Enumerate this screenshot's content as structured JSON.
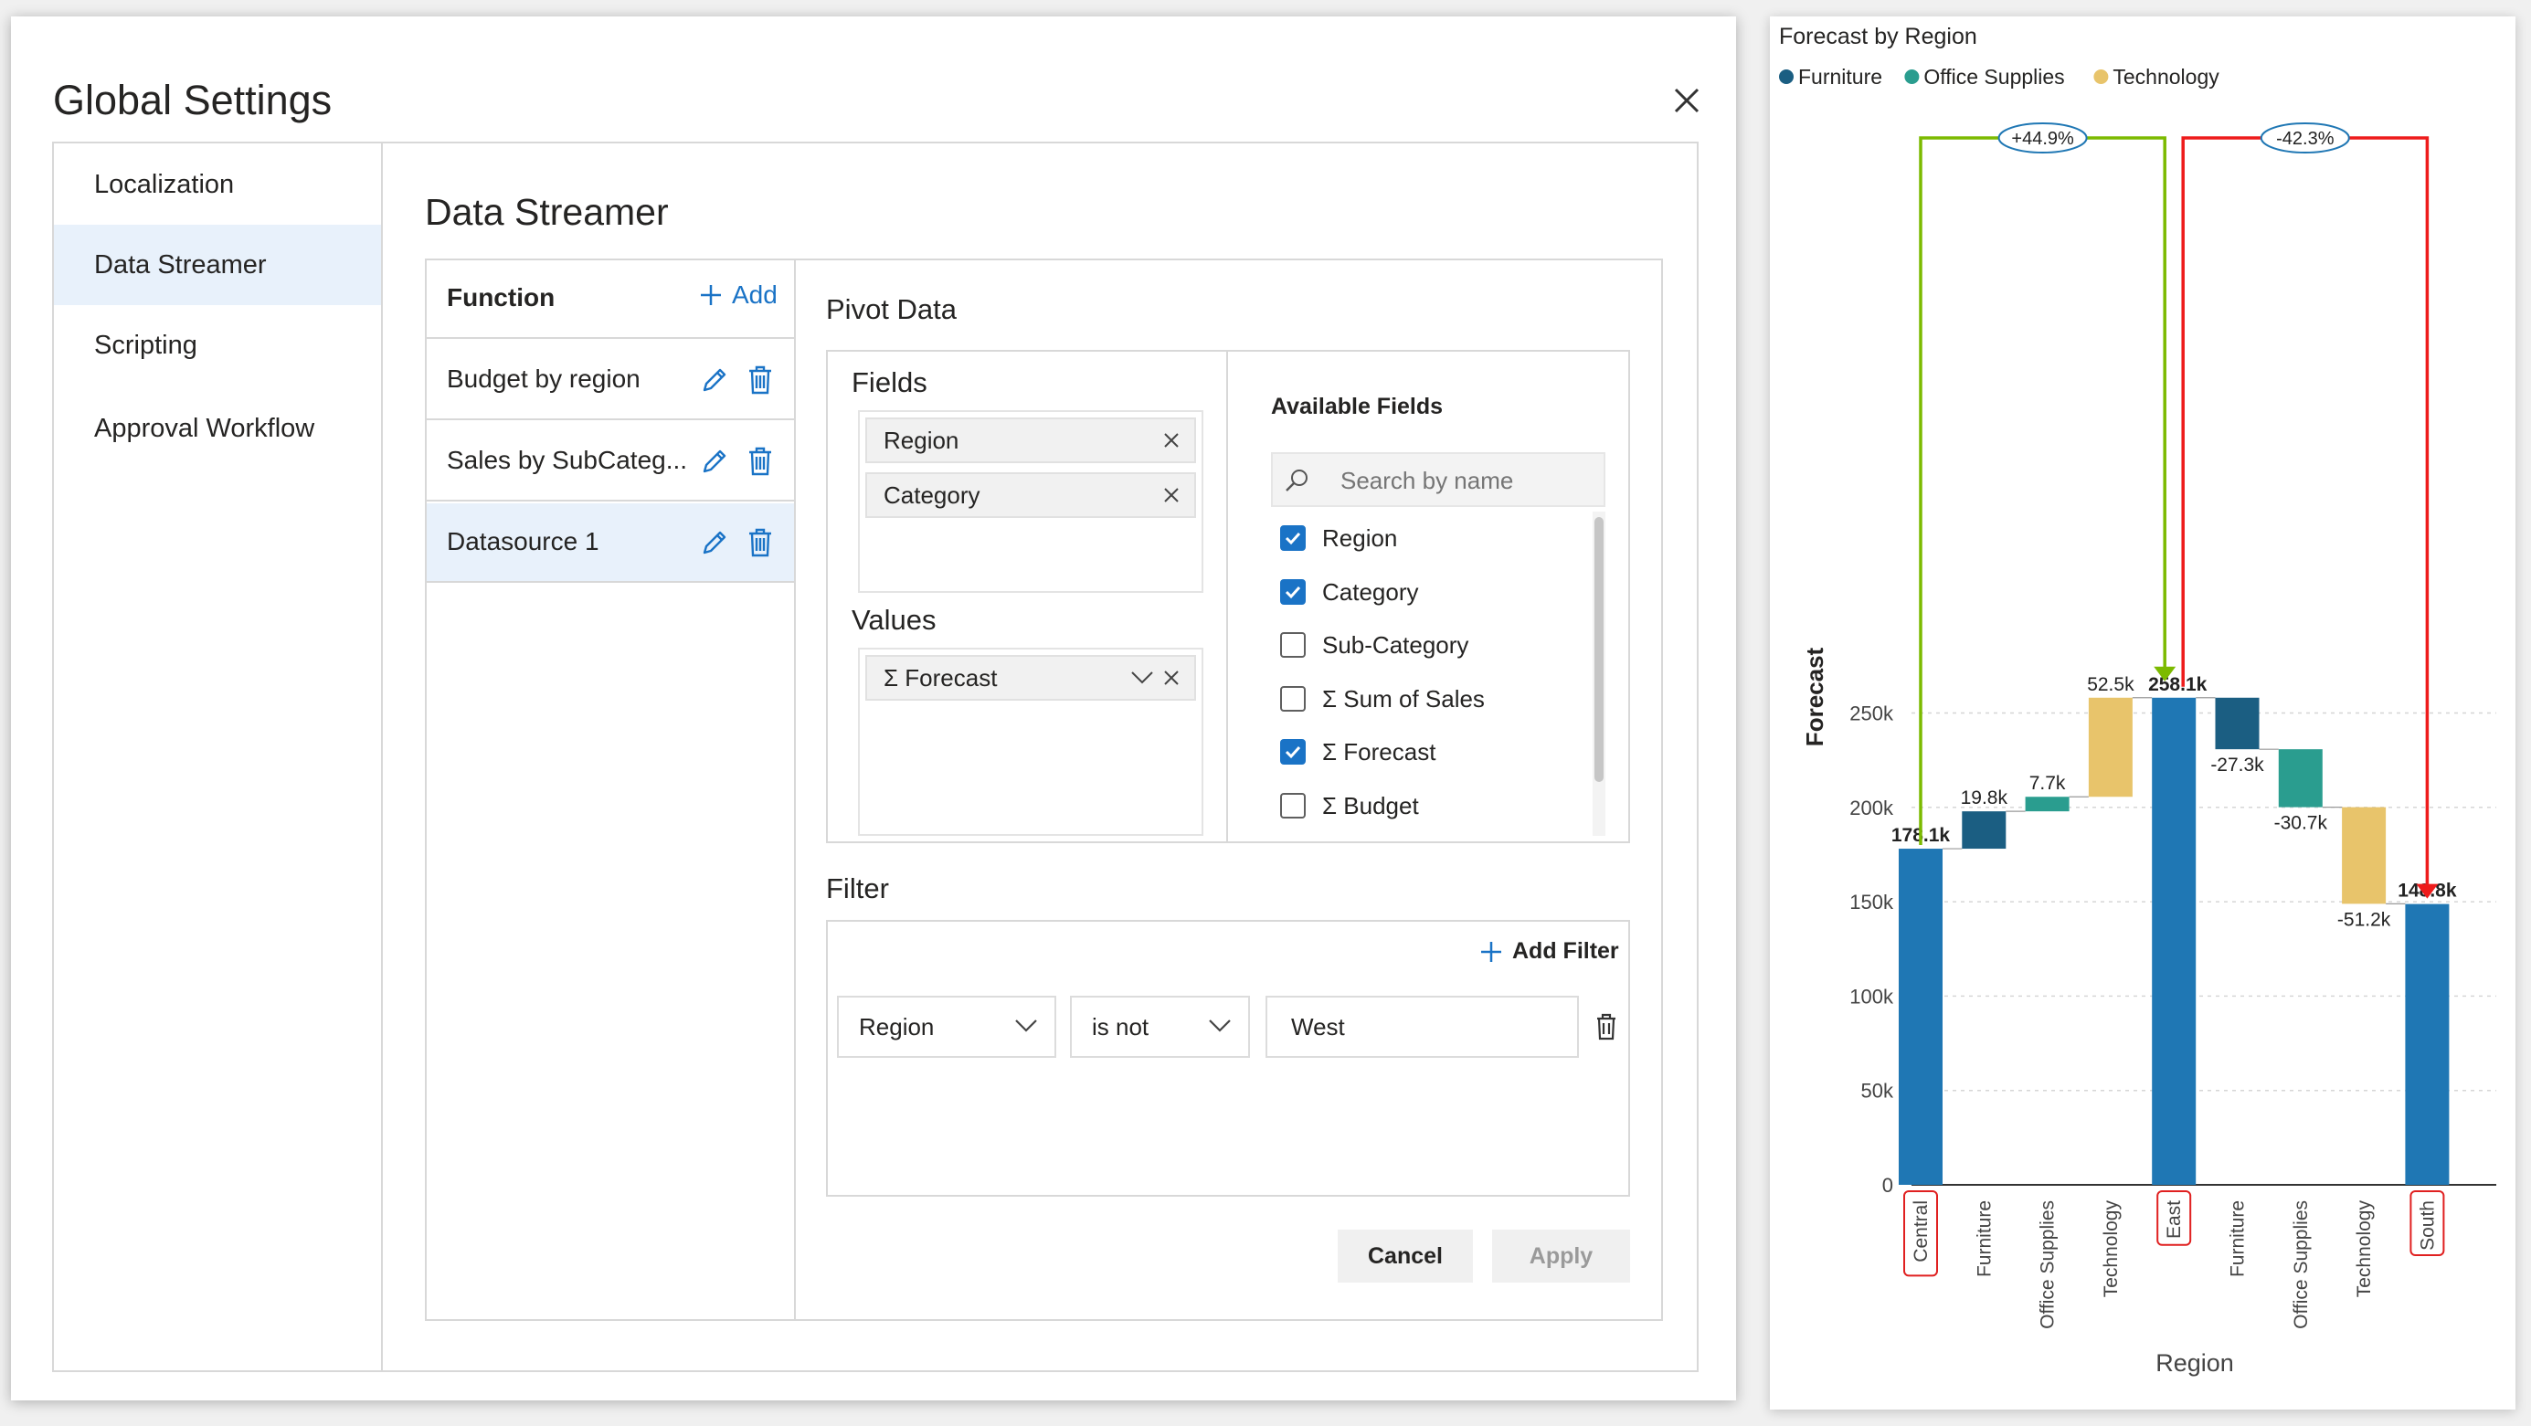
{
  "dialog": {
    "title": "Global Settings",
    "nav": [
      "Localization",
      "Data Streamer",
      "Scripting",
      "Approval Workflow"
    ],
    "active_nav": "Data Streamer",
    "section_title": "Data Streamer",
    "functions": {
      "header": "Function",
      "add_label": "Add",
      "items": [
        "Budget by region",
        "Sales by SubCateg...",
        "Datasource 1"
      ],
      "active_item": "Datasource 1"
    },
    "pivot": {
      "title": "Pivot Data",
      "fields_title": "Fields",
      "fields": [
        "Region",
        "Category"
      ],
      "values_title": "Values",
      "values": [
        "Σ Forecast"
      ],
      "available_title": "Available Fields",
      "search_placeholder": "Search by name",
      "available": [
        {
          "label": "Region",
          "checked": true
        },
        {
          "label": "Category",
          "checked": true
        },
        {
          "label": "Sub-Category",
          "checked": false
        },
        {
          "label": "Σ Sum of Sales",
          "checked": false
        },
        {
          "label": "Σ Forecast",
          "checked": true
        },
        {
          "label": "Σ Budget",
          "checked": false
        }
      ]
    },
    "filter": {
      "title": "Filter",
      "add_label": "Add Filter",
      "field": "Region",
      "operator": "is not",
      "value": "West"
    },
    "buttons": {
      "cancel": "Cancel",
      "apply": "Apply"
    }
  },
  "chart_data": {
    "type": "waterfall",
    "title": "Forecast by Region",
    "legend": [
      {
        "name": "Furniture",
        "color": "#1b5e82"
      },
      {
        "name": "Office Supplies",
        "color": "#2a9d8f"
      },
      {
        "name": "Technology",
        "color": "#e8c46b"
      }
    ],
    "total_color": "#1f77b4",
    "xlabel": "Region",
    "ylabel": "Forecast",
    "ylim": [
      0,
      258.1
    ],
    "yticks": [
      {
        "value": 0,
        "label": "0"
      },
      {
        "value": 50,
        "label": "50k"
      },
      {
        "value": 100,
        "label": "100k"
      },
      {
        "value": 150,
        "label": "150k"
      },
      {
        "value": 200,
        "label": "200k"
      },
      {
        "value": 250,
        "label": "250k"
      }
    ],
    "bars": [
      {
        "label": "Central",
        "kind": "total",
        "value": 178.1,
        "text": "178.1k",
        "highlighted": true
      },
      {
        "label": "Furniture",
        "kind": "delta",
        "series": "Furniture",
        "value": 19.8,
        "text": "19.8k"
      },
      {
        "label": "Office Supplies",
        "kind": "delta",
        "series": "Office Supplies",
        "value": 7.7,
        "text": "7.7k"
      },
      {
        "label": "Technology",
        "kind": "delta",
        "series": "Technology",
        "value": 52.5,
        "text": "52.5k"
      },
      {
        "label": "East",
        "kind": "total",
        "value": 258.1,
        "text": "258.1k",
        "highlighted": true
      },
      {
        "label": "Furniture",
        "kind": "delta",
        "series": "Furniture",
        "value": -27.3,
        "text": "-27.3k"
      },
      {
        "label": "Office Supplies",
        "kind": "delta",
        "series": "Office Supplies",
        "value": -30.7,
        "text": "-30.7k"
      },
      {
        "label": "Technology",
        "kind": "delta",
        "series": "Technology",
        "value": -51.2,
        "text": "-51.2k"
      },
      {
        "label": "South",
        "kind": "total",
        "value": 148.8,
        "text": "148.8k",
        "highlighted": true
      }
    ],
    "comparisons": [
      {
        "from": 0,
        "to": 4,
        "text": "+44.9%",
        "color": "#7cba00"
      },
      {
        "from": 4,
        "to": 8,
        "text": "-42.3%",
        "color": "#ee1c1c"
      }
    ]
  }
}
